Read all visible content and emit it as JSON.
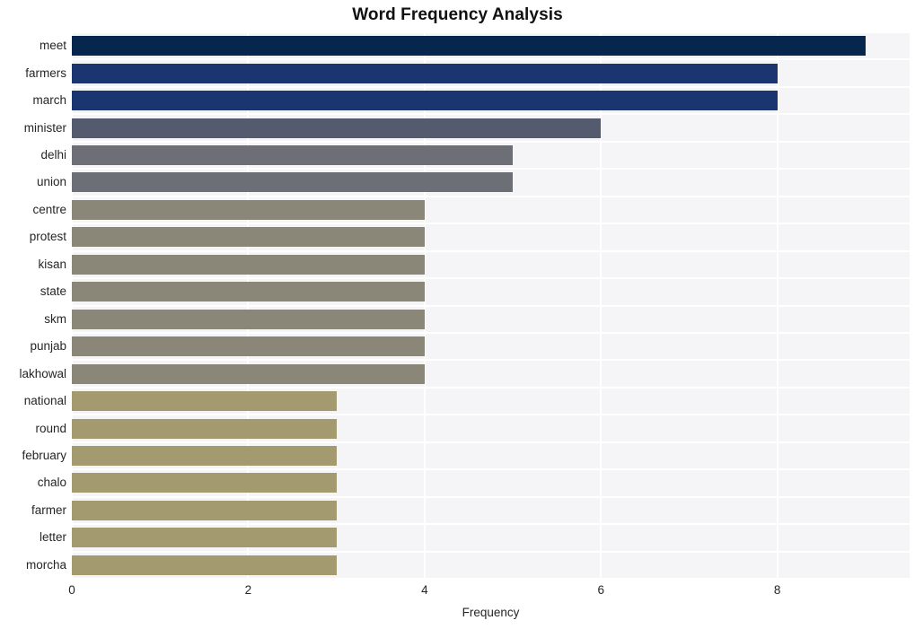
{
  "chart_data": {
    "type": "bar",
    "orientation": "horizontal",
    "title": "Word Frequency Analysis",
    "xlabel": "Frequency",
    "ylabel": "",
    "xlim": [
      0,
      9.5
    ],
    "xticks": [
      0,
      2,
      4,
      6,
      8
    ],
    "xtick_labels": [
      "0",
      "2",
      "4",
      "6",
      "8"
    ],
    "grid": true,
    "legend": "none",
    "categories": [
      "meet",
      "farmers",
      "march",
      "minister",
      "delhi",
      "union",
      "centre",
      "protest",
      "kisan",
      "state",
      "skm",
      "punjab",
      "lakhowal",
      "national",
      "round",
      "february",
      "chalo",
      "farmer",
      "letter",
      "morcha"
    ],
    "values": [
      9,
      8,
      8,
      6,
      5,
      5,
      4,
      4,
      4,
      4,
      4,
      4,
      4,
      3,
      3,
      3,
      3,
      3,
      3,
      3
    ],
    "bar_colors": [
      "#07264d",
      "#1a3570",
      "#1a3570",
      "#555b6e",
      "#6d6f76",
      "#6d6f76",
      "#8a8778",
      "#8a8778",
      "#8a8778",
      "#8a8778",
      "#8a8778",
      "#8a8778",
      "#8a8778",
      "#a49a70",
      "#a49a70",
      "#a49a70",
      "#a49a70",
      "#a49a70",
      "#a49a70",
      "#a49a70"
    ],
    "plot_background": "#f5f5f7",
    "gridline_color": "#ffffff"
  }
}
